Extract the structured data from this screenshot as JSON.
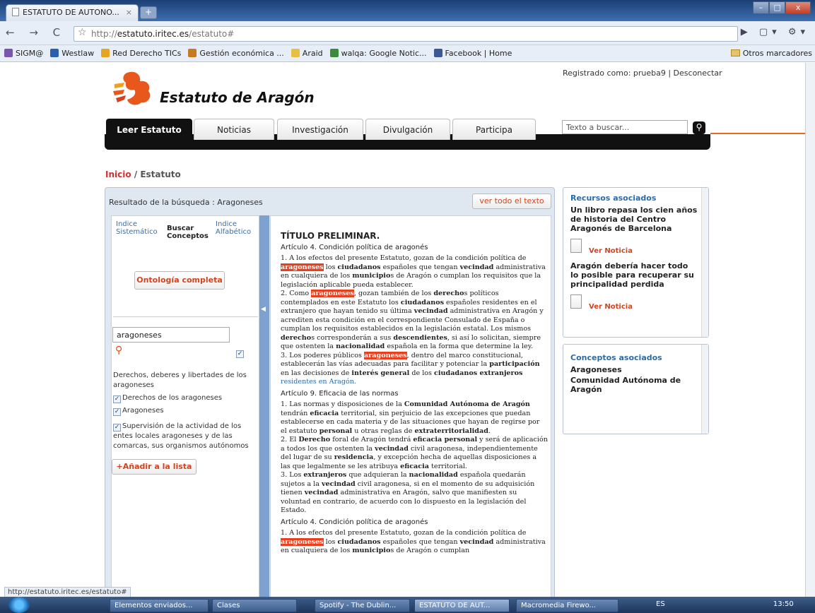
{
  "browser": {
    "tab_title": "ESTATUTO DE AUTONO...",
    "tab_close": "×",
    "new_tab": "+",
    "url_prefix": "http://",
    "url_host": "estatuto.iritec.es",
    "url_path": "/estatuto#",
    "nav_glyphs": "← → C",
    "star": "☆",
    "toolbar_right": "▶ ▢▾ ⚙▾",
    "bookmarks": [
      {
        "label": "SIGM@",
        "color": "#7a55b0"
      },
      {
        "label": "Westlaw",
        "color": "#2a5fb0"
      },
      {
        "label": "Red Derecho TICs",
        "color": "#e6a520"
      },
      {
        "label": "Gestión económica ...",
        "color": "#c87a20"
      },
      {
        "label": "Araid",
        "color": "#e8c040"
      },
      {
        "label": "walqa: Google Notic...",
        "color": "#3c8a3c"
      },
      {
        "label": "Facebook | Home",
        "color": "#3b5998"
      }
    ],
    "other_bookmarks": "Otros marcadores",
    "status_url": "http://estatuto.iritec.es/estatuto#"
  },
  "site": {
    "title": "Estatuto de Aragón",
    "login_text": "Registrado como: prueba9 | Desconectar",
    "nav_tabs": [
      "Leer Estatuto",
      "Noticias",
      "Investigación",
      "Divulgación",
      "Participa"
    ],
    "search_placeholder": "Texto a buscar...",
    "search_icon": "search-icon",
    "breadcrumb": {
      "home": "Inicio",
      "sep": " / ",
      "current": "Estatuto"
    }
  },
  "panel": {
    "result_label": "Resultado de la búsqueda : Aragoneses",
    "ver_todo": "ver todo el texto",
    "left_tabs": [
      {
        "line1": "Indice",
        "line2": "Sistemático"
      },
      {
        "line1": "Buscar",
        "line2": "Conceptos"
      },
      {
        "line1": "Indice",
        "line2": "Alfabético"
      }
    ],
    "ontologia": "Ontología completa",
    "concept_input": "aragoneses",
    "category": "Derechos, deberes y libertades de los aragoneses",
    "checked_items": [
      "Derechos de los aragoneses",
      "Aragoneses",
      "Supervisión de la actividad de los entes locales aragoneses y de las comarcas, sus organismos autónomos"
    ],
    "add_button": "+Añadir a la lista"
  },
  "text": {
    "heading": "TÍTULO PRELIMINAR.",
    "art4_title": "Artículo 4. Condición política de aragonés",
    "art9_title": "Artículo 9. Eficacia de las normas",
    "art4b_title": "Artículo 4. Condición política de aragonés"
  },
  "sidebar": {
    "recursos_title": "Recursos asociados",
    "news": [
      {
        "title": "Un libro repasa los cien años de historia del Centro Aragonés de Barcelona",
        "link": "Ver Noticia"
      },
      {
        "title": "Aragón debería hacer todo lo posible para recuperar su principalidad perdida",
        "link": "Ver Noticia"
      }
    ],
    "conceptos_title": "Conceptos asociados",
    "conceptos": [
      "Aragoneses",
      "Comunidad Autónoma de Aragón"
    ]
  },
  "taskbar": {
    "windows": [
      "Elementos enviados...",
      "Clases",
      "Spotify - The Dublin...",
      "ESTATUTO DE AUT...",
      "Macromedia Firewo..."
    ],
    "lang": "ES",
    "clock": "13:50"
  }
}
